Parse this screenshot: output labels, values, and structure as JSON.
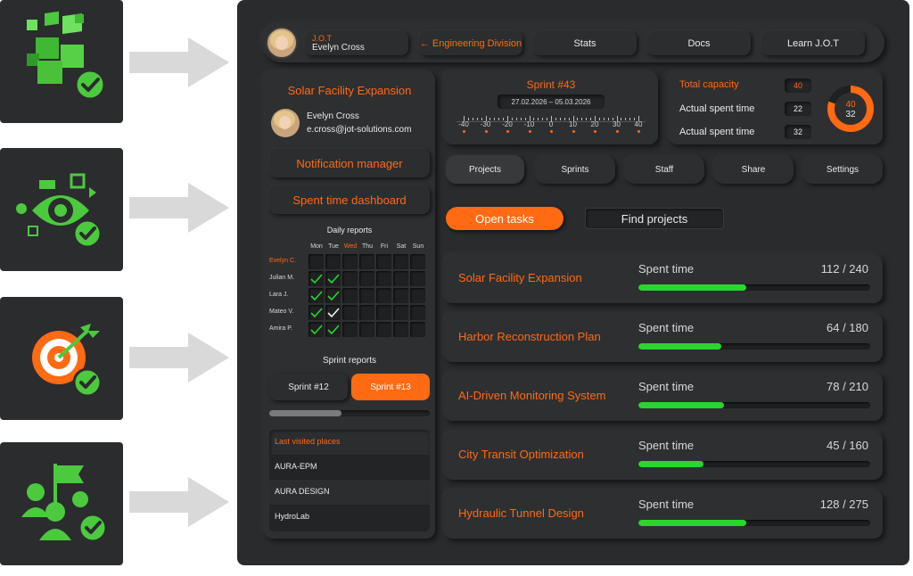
{
  "header": {
    "user_title": "J.O.T",
    "user_name": "Evelyn Cross",
    "division": "← Engineering Division",
    "nav": [
      "Stats",
      "Docs",
      "Learn J.O.T"
    ]
  },
  "sidebar": {
    "project_title": "Solar Facility Expansion",
    "user_name": "Evelyn Cross",
    "user_email": "e.cross@jot-solutions.com",
    "buttons": [
      "Notification manager",
      "Spent time dashboard"
    ],
    "daily_reports": {
      "title": "Daily reports",
      "days": [
        "Mon",
        "Tue",
        "Wed",
        "Thu",
        "Fri",
        "Sat",
        "Sun"
      ],
      "highlight_day": "Wed",
      "people": [
        {
          "name": "Evelyn C.",
          "highlight": true,
          "checks": [
            0,
            0
          ]
        },
        {
          "name": "Julian M.",
          "highlight": false,
          "checks": [
            1,
            1
          ]
        },
        {
          "name": "Lara J.",
          "highlight": false,
          "checks": [
            1,
            1
          ]
        },
        {
          "name": "Mateo V.",
          "highlight": false,
          "checks": [
            1,
            2
          ]
        },
        {
          "name": "Amira P.",
          "highlight": false,
          "checks": [
            1,
            1
          ]
        }
      ]
    },
    "sprint_reports": {
      "title": "Sprint reports",
      "buttons": [
        "Sprint #12",
        "Sprint #13"
      ],
      "active": "Sprint #13",
      "scroll_fraction": 0.45
    },
    "last_visited": {
      "title": "Last visited places",
      "items": [
        "AURA-EPM",
        "AURA DESIGN",
        "HydroLab"
      ]
    }
  },
  "sprint": {
    "title": "Sprint #43",
    "dates": "27.02.2026 – 05.03.2026",
    "ruler": [
      "-40",
      "-30",
      "-20",
      "-10",
      "0",
      "10",
      "20",
      "30",
      "40"
    ]
  },
  "capacity": {
    "rows": [
      {
        "label": "Total capacity",
        "value": "40",
        "accent": true
      },
      {
        "label": "Actual spent time",
        "value": "22",
        "accent": false
      },
      {
        "label": "Actual spent time",
        "value": "32",
        "accent": false
      }
    ],
    "donut_top": "40",
    "donut_bottom": "32",
    "donut_fraction": 0.8
  },
  "tabs": [
    "Projects",
    "Sprints",
    "Staff",
    "Share",
    "Settings"
  ],
  "actions": {
    "open_tasks": "Open tasks",
    "find_projects": "Find projects"
  },
  "spent_label": "Spent time",
  "projects": [
    {
      "name": "Solar Facility Expansion",
      "spent": "112 / 240",
      "fraction": 0.467
    },
    {
      "name": "Harbor Reconstruction Plan",
      "spent": "64 / 180",
      "fraction": 0.356
    },
    {
      "name": "AI-Driven Monitoring System",
      "spent": "78 / 210",
      "fraction": 0.371
    },
    {
      "name": "City Transit Optimization",
      "spent": "45 / 160",
      "fraction": 0.281
    },
    {
      "name": "Hydraulic Tunnel Design",
      "spent": "128 / 275",
      "fraction": 0.465
    }
  ],
  "colors": {
    "accent": "#ff6a13",
    "green": "#28d62e",
    "icon_green": "#4cc93e",
    "panel": "#2e2f31"
  },
  "icons": [
    "cubes-check-icon",
    "eye-gears-check-icon",
    "target-arrow-check-icon",
    "team-flag-check-icon"
  ]
}
